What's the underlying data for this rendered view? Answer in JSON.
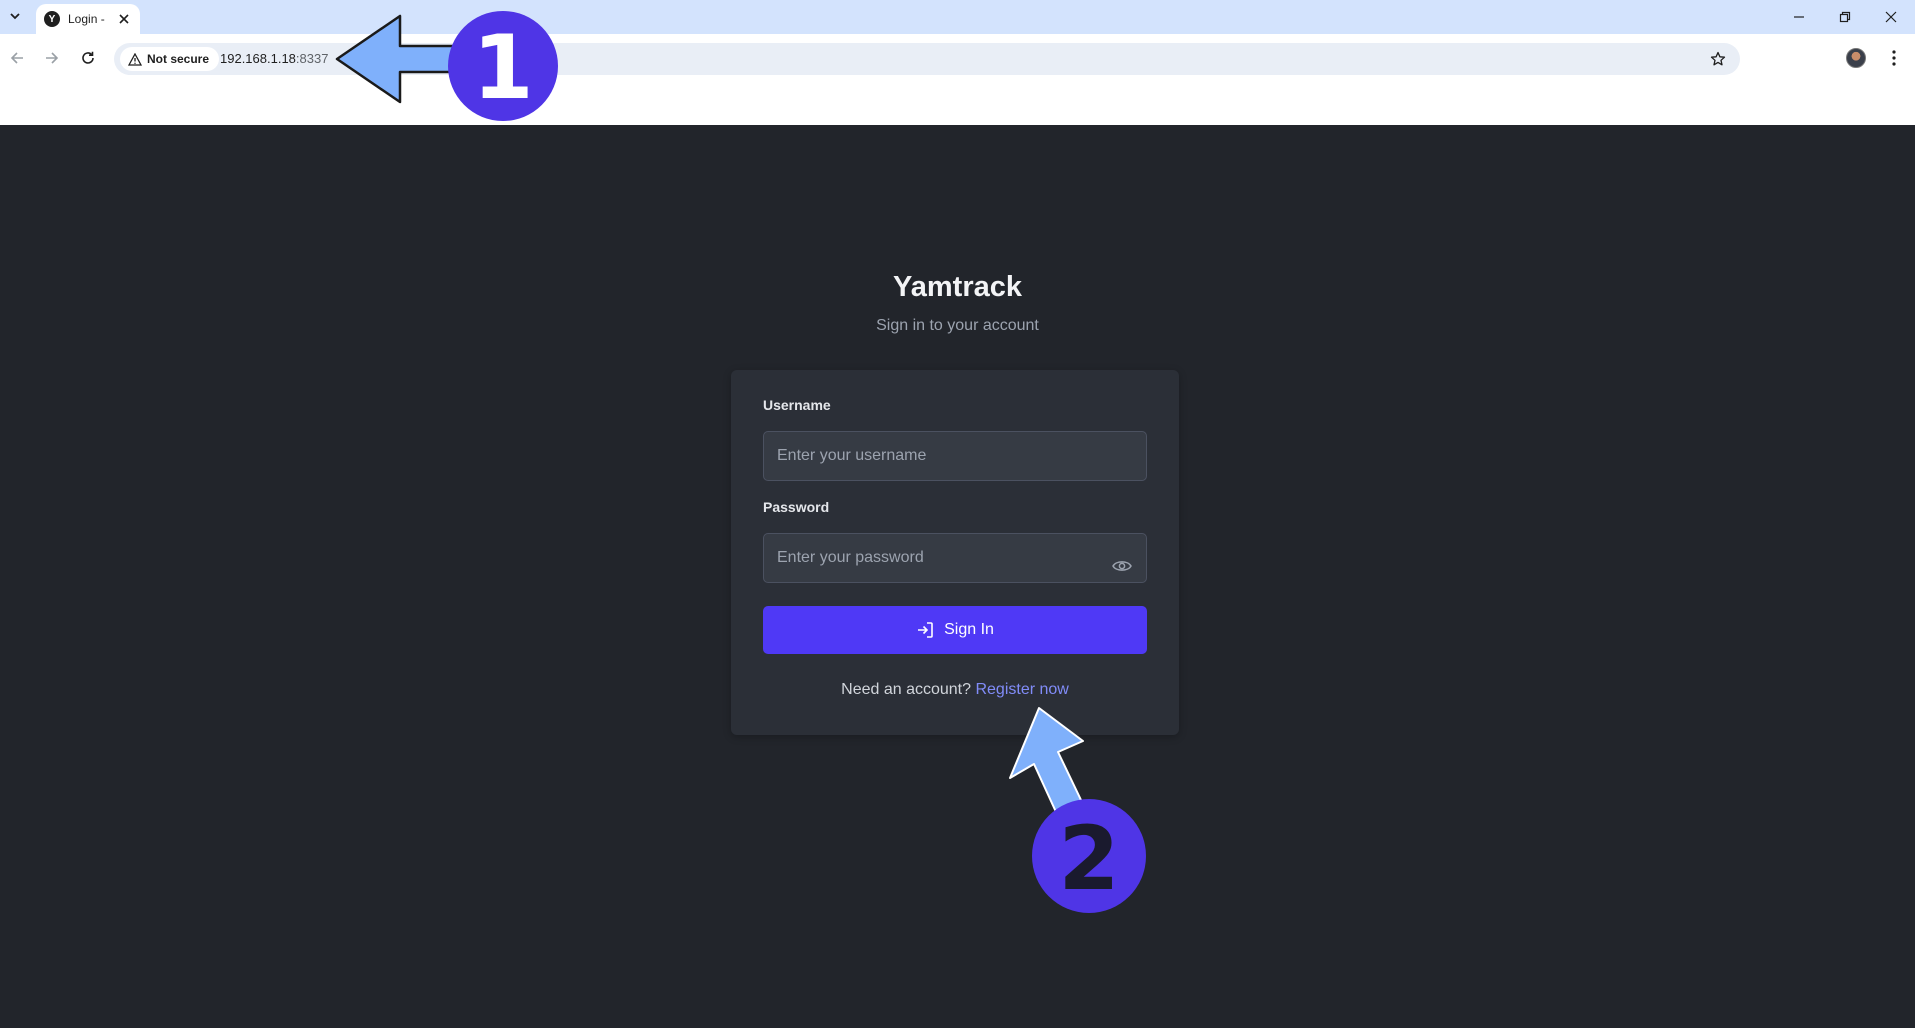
{
  "browser": {
    "tab_title": "Login -",
    "favicon_letter": "Y",
    "security_label": "Not secure",
    "url_host": "192.168.1.18",
    "url_port": ":8337"
  },
  "app": {
    "title": "Yamtrack",
    "subtitle": "Sign in to your account"
  },
  "form": {
    "username_label": "Username",
    "username_placeholder": "Enter your username",
    "password_label": "Password",
    "password_placeholder": "Enter your password",
    "signin_label": "Sign In",
    "register_prompt": "Need an account?",
    "register_link": "Register now"
  },
  "annotations": {
    "step1": "1",
    "step2": "2",
    "badge_color": "#4f35e6",
    "arrow_color": "#7fb0fb"
  },
  "colors": {
    "page_bg": "#22252b",
    "card_bg": "#2b2f37",
    "accent": "#4f39f6",
    "link": "#818cf8"
  }
}
